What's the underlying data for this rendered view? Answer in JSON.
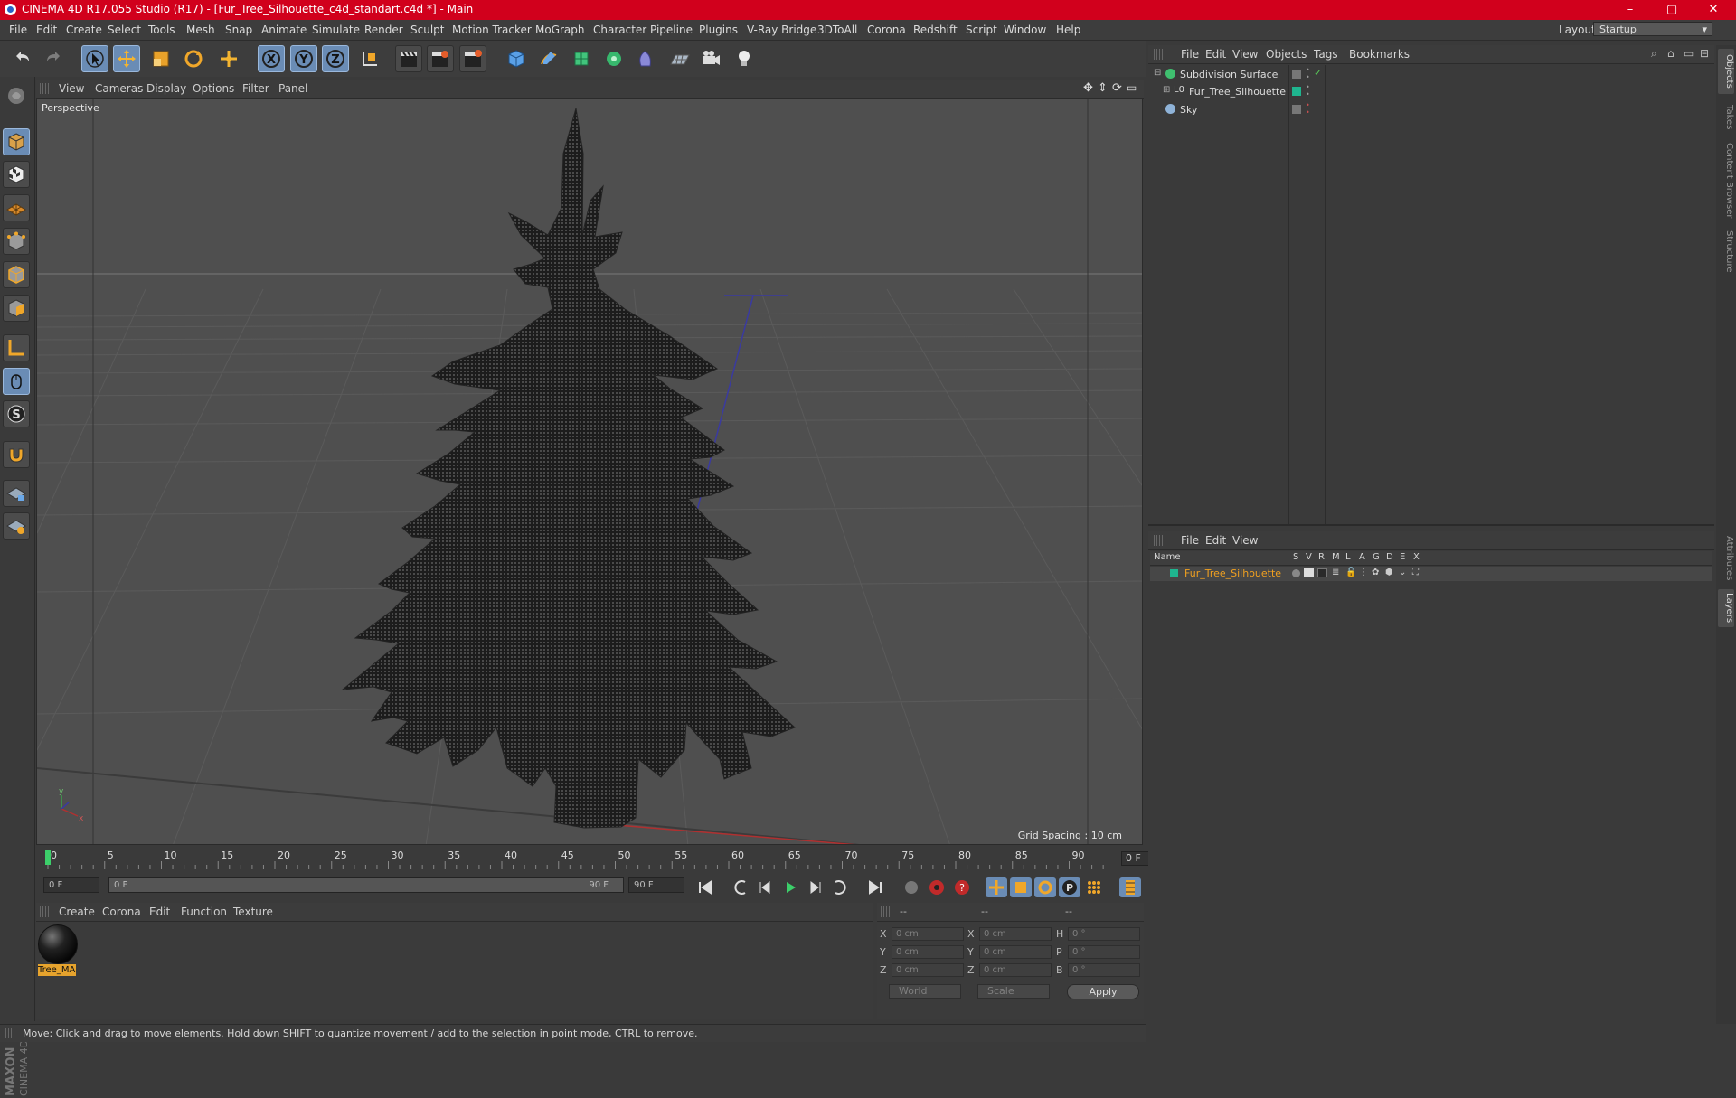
{
  "window": {
    "title": "CINEMA 4D R17.055 Studio (R17) - [Fur_Tree_Silhouette_c4d_standart.c4d *] - Main",
    "minimize": "–",
    "maximize": "▢",
    "close": "✕"
  },
  "menu": [
    "File",
    "Edit",
    "Create",
    "Select",
    "Tools",
    "Mesh",
    "Snap",
    "Animate",
    "Simulate",
    "Render",
    "Sculpt",
    "Motion Tracker",
    "MoGraph",
    "Character",
    "Pipeline",
    "Plugins",
    "V-Ray Bridge",
    "3DToAll",
    "Corona",
    "Redshift",
    "Script",
    "Window",
    "Help"
  ],
  "layout": {
    "label": "Layout:",
    "value": "Startup"
  },
  "viewport": {
    "menu": [
      "View",
      "Cameras",
      "Display",
      "Options",
      "Filter",
      "Panel"
    ],
    "label": "Perspective",
    "grid_spacing": "Grid Spacing : 10 cm"
  },
  "timeline": {
    "ticks": [
      "0",
      "5",
      "10",
      "15",
      "20",
      "25",
      "30",
      "35",
      "40",
      "45",
      "50",
      "55",
      "60",
      "65",
      "70",
      "75",
      "80",
      "85",
      "90"
    ],
    "current_frame": "0 F",
    "start_field": "0 F",
    "range_start": "0 F",
    "range_end": "90 F",
    "end_field": "90 F"
  },
  "materials": {
    "menu": [
      "Create",
      "Corona",
      "Edit",
      "Function",
      "Texture"
    ],
    "items": [
      {
        "name": "Tree_MA"
      }
    ]
  },
  "coordinates": {
    "headers": [
      "--",
      "--",
      "--"
    ],
    "rows": [
      {
        "a": "X",
        "av": "0 cm",
        "b": "X",
        "bv": "0 cm",
        "c": "H",
        "cv": "0 °"
      },
      {
        "a": "Y",
        "av": "0 cm",
        "b": "Y",
        "bv": "0 cm",
        "c": "P",
        "cv": "0 °"
      },
      {
        "a": "Z",
        "av": "0 cm",
        "b": "Z",
        "bv": "0 cm",
        "c": "B",
        "cv": "0 °"
      }
    ],
    "space": "World",
    "mode": "Scale",
    "apply": "Apply"
  },
  "status": "Move: Click and drag to move elements. Hold down SHIFT to quantize movement / add to the selection in point mode, CTRL to remove.",
  "objects": {
    "menu": [
      "File",
      "Edit",
      "View",
      "Objects",
      "Tags",
      "Bookmarks"
    ],
    "items": [
      {
        "name": "Subdivision Surface"
      },
      {
        "name": "Fur_Tree_Silhouette"
      },
      {
        "name": "Sky"
      }
    ]
  },
  "layers": {
    "menu": [
      "File",
      "Edit",
      "View"
    ],
    "columns": [
      "Name",
      "S",
      "V",
      "R",
      "M",
      "L",
      "A",
      "G",
      "D",
      "E",
      "X"
    ],
    "items": [
      {
        "name": "Fur_Tree_Silhouette"
      }
    ]
  },
  "right_tabs": [
    "Objects",
    "Takes",
    "Content Browser",
    "Structure",
    "Attributes",
    "Layers"
  ],
  "logo": {
    "line1": "MAXON",
    "line2": "CINEMA 4D"
  },
  "colors": {
    "accent": "#d1001c",
    "selection": "#6a8cb5",
    "layer_green": "#1fb58f",
    "highlight_text": "#f0a020"
  }
}
